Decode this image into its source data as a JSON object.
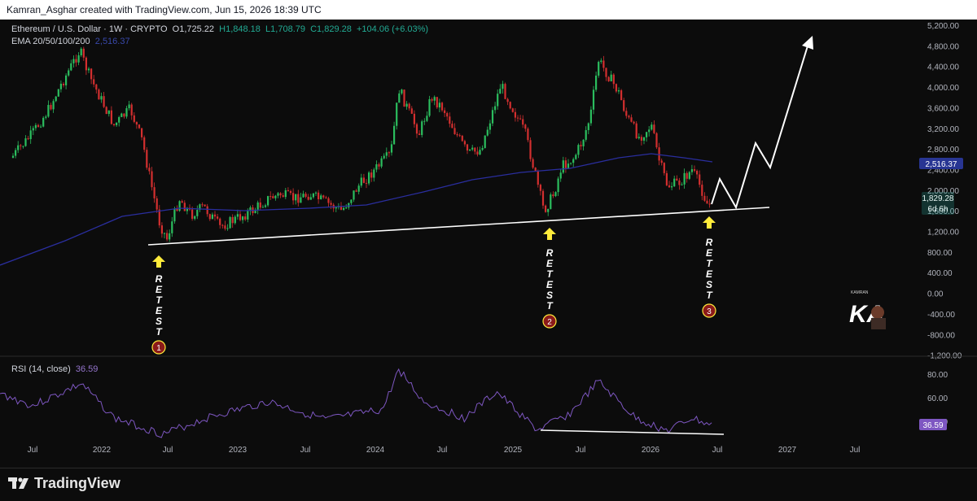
{
  "header": {
    "attribution": "Kamran_Asghar created with TradingView.com, Jun 15, 2026 18:39 UTC"
  },
  "legend": {
    "symbol": "Ethereum / U.S. Dollar · 1W · CRYPTO",
    "open": "O1,725.22",
    "high": "H1,848.18",
    "low": "L1,708.79",
    "close": "C1,829.28",
    "change": "+104.06 (+6.03%)",
    "ema": "EMA 20/50/100/200",
    "ema_value": "2,516.37"
  },
  "rsi_legend": {
    "label": "RSI (14, close)",
    "value": "36.59"
  },
  "price_axis": [
    "5,200.00",
    "4,800.00",
    "4,400.00",
    "4,000.00",
    "3,600.00",
    "3,200.00",
    "2,800.00",
    "2,400.00",
    "2,000.00",
    "1,600.00",
    "1,200.00",
    "800.00",
    "400.00",
    "0.00",
    "-400.00",
    "-800.00",
    "-1,200.00"
  ],
  "price_tags": {
    "ema": "2,516.37",
    "last": "1,829.28",
    "countdown": "6d 6h"
  },
  "rsi_axis": [
    "80.00",
    "60.00",
    "40.00"
  ],
  "rsi_tag": "36.59",
  "time_axis": [
    "Jul",
    "2022",
    "Jul",
    "2023",
    "Jul",
    "2024",
    "Jul",
    "2025",
    "Jul",
    "2026",
    "Jul",
    "2027",
    "Jul"
  ],
  "annotations": {
    "retest_1": "RETEST",
    "retest_2": "RETEST",
    "retest_3": "RETEST",
    "num_1": "1",
    "num_2": "2",
    "num_3": "3"
  },
  "watermark": {
    "letters": "KA",
    "small": "KAMRAN"
  },
  "footer": {
    "brand": "TradingView"
  },
  "colors": {
    "up": "#26a69a",
    "up_bright": "#4caf50",
    "down": "#ef5350",
    "ema": "#2a2e9e",
    "rsi": "#7e57c2",
    "arrow": "#ffeb3b",
    "retest_circle": "#8b1a1a"
  }
}
